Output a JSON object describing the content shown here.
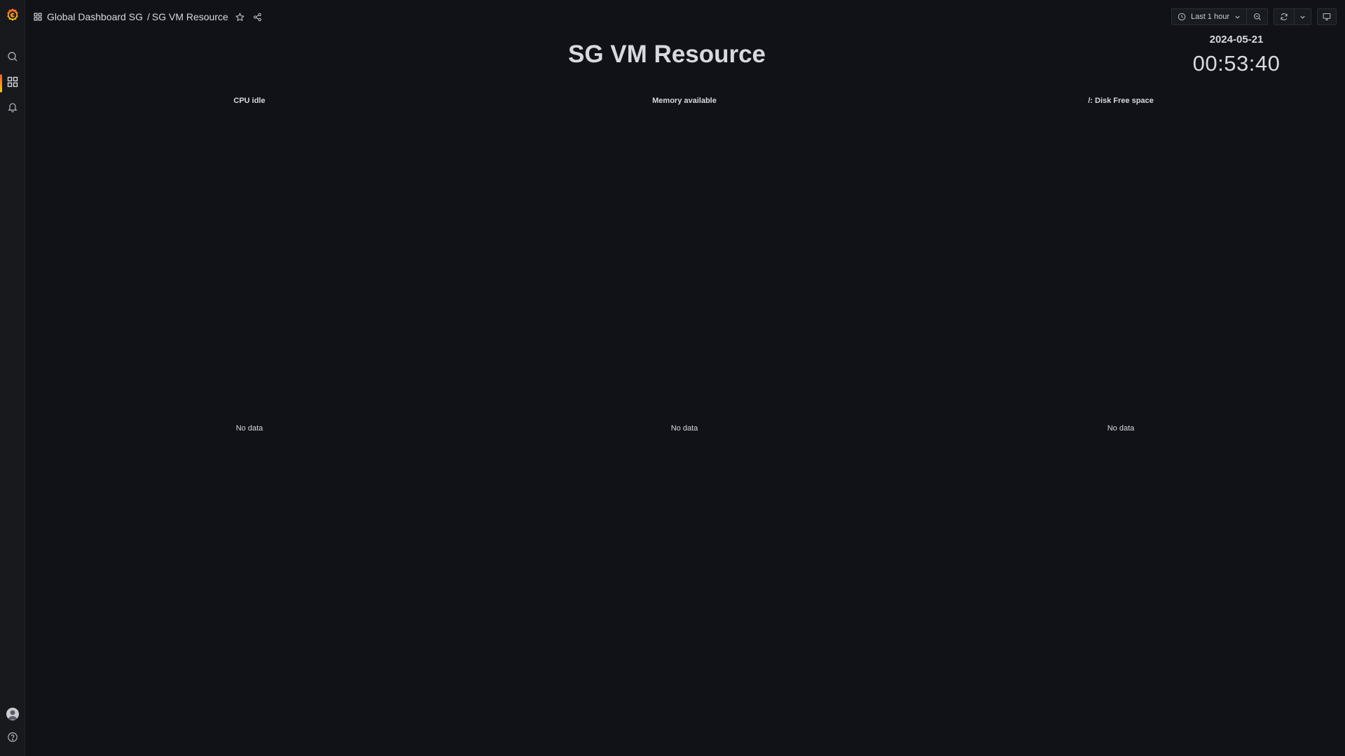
{
  "header": {
    "breadcrumb_folder": "Global Dashboard SG",
    "breadcrumb_separator": "/",
    "dashboard_title": "SG VM Resource",
    "time_range": "Last 1 hour"
  },
  "clock": {
    "date": "2024-05-21",
    "time": "00:53:40"
  },
  "dashboard": {
    "title": "SG VM Resource"
  },
  "panels": [
    {
      "title": "CPU idle",
      "status": "No data"
    },
    {
      "title": "Memory available",
      "status": "No data"
    },
    {
      "title": "/: Disk Free space",
      "status": "No data"
    }
  ],
  "icons": {
    "logo": "grafana-logo-icon",
    "search": "search-icon",
    "dashboards": "dashboards-icon",
    "alerting": "bell-icon",
    "profile": "avatar",
    "help": "help-icon"
  },
  "colors": {
    "background": "#111217",
    "sidebar": "#18191d",
    "accent_orange": "#f05a28",
    "accent_yellow": "#fbca0a",
    "text": "#d8d9e0"
  }
}
